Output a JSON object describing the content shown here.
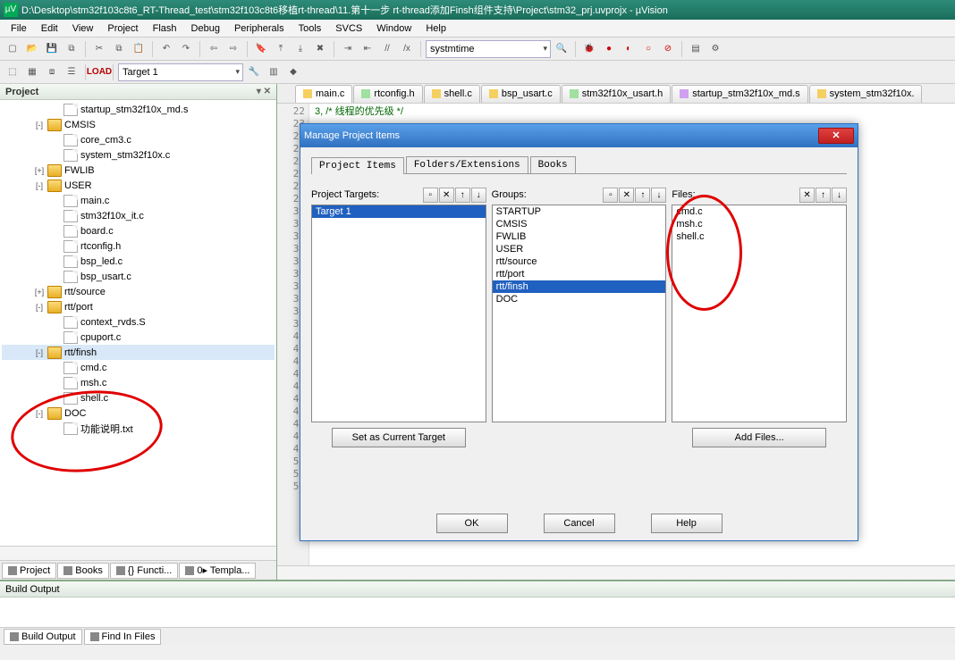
{
  "title": "D:\\Desktop\\stm32f103c8t6_RT-Thread_test\\stm32f103c8t6移植rt-thread\\11.第十一步 rt-thread添加Finsh组件支持\\Project\\stm32_prj.uvprojx - µVision",
  "menu": [
    "File",
    "Edit",
    "View",
    "Project",
    "Flash",
    "Debug",
    "Peripherals",
    "Tools",
    "SVCS",
    "Window",
    "Help"
  ],
  "toolbar2": {
    "target": "Target 1",
    "search": "systmtime"
  },
  "project_pane": {
    "title": "Project",
    "tabs": [
      "Project",
      "Books",
      "{} Functi...",
      "0▸ Templa..."
    ]
  },
  "tree": [
    {
      "d": 3,
      "t": "file",
      "l": "startup_stm32f10x_md.s"
    },
    {
      "d": 2,
      "t": "folder",
      "e": "-",
      "l": "CMSIS"
    },
    {
      "d": 3,
      "t": "file",
      "l": "core_cm3.c"
    },
    {
      "d": 3,
      "t": "file",
      "l": "system_stm32f10x.c"
    },
    {
      "d": 2,
      "t": "folder",
      "e": "+",
      "l": "FWLIB"
    },
    {
      "d": 2,
      "t": "folder",
      "e": "-",
      "l": "USER"
    },
    {
      "d": 3,
      "t": "file",
      "l": "main.c"
    },
    {
      "d": 3,
      "t": "file",
      "l": "stm32f10x_it.c"
    },
    {
      "d": 3,
      "t": "file",
      "l": "board.c"
    },
    {
      "d": 3,
      "t": "file",
      "l": "rtconfig.h"
    },
    {
      "d": 3,
      "t": "file",
      "l": "bsp_led.c"
    },
    {
      "d": 3,
      "t": "file",
      "l": "bsp_usart.c"
    },
    {
      "d": 2,
      "t": "folder",
      "e": "+",
      "l": "rtt/source"
    },
    {
      "d": 2,
      "t": "folder",
      "e": "-",
      "l": "rtt/port"
    },
    {
      "d": 3,
      "t": "file",
      "l": "context_rvds.S"
    },
    {
      "d": 3,
      "t": "file",
      "l": "cpuport.c"
    },
    {
      "d": 2,
      "t": "folder",
      "e": "-",
      "l": "rtt/finsh",
      "sel": true
    },
    {
      "d": 3,
      "t": "file",
      "l": "cmd.c"
    },
    {
      "d": 3,
      "t": "file",
      "l": "msh.c"
    },
    {
      "d": 3,
      "t": "file",
      "l": "shell.c"
    },
    {
      "d": 2,
      "t": "folder",
      "e": "-",
      "l": "DOC"
    },
    {
      "d": 3,
      "t": "file",
      "l": "功能说明.txt"
    }
  ],
  "editor_tabs": [
    {
      "l": "main.c",
      "k": "c",
      "a": true
    },
    {
      "l": "rtconfig.h",
      "k": "h"
    },
    {
      "l": "shell.c",
      "k": "c"
    },
    {
      "l": "bsp_usart.c",
      "k": "c"
    },
    {
      "l": "stm32f10x_usart.h",
      "k": "h"
    },
    {
      "l": "startup_stm32f10x_md.s",
      "k": "s"
    },
    {
      "l": "system_stm32f10x.",
      "k": "c"
    }
  ],
  "gutter_start": 22,
  "gutter_end": 52,
  "code_line": "3,                           /*  线程的优先级  */",
  "buildout": {
    "title": "Build Output",
    "tabs": [
      "Build Output",
      "Find In Files"
    ]
  },
  "dialog": {
    "title": "Manage Project Items",
    "tabs": [
      "Project Items",
      "Folders/Extensions",
      "Books"
    ],
    "col1": {
      "label": "Project Targets:",
      "items": [
        "Target 1"
      ],
      "sel": 0,
      "btn": "Set as Current Target"
    },
    "col2": {
      "label": "Groups:",
      "items": [
        "STARTUP",
        "CMSIS",
        "FWLIB",
        "USER",
        "rtt/source",
        "rtt/port",
        "rtt/finsh",
        "DOC"
      ],
      "sel": 6
    },
    "col3": {
      "label": "Files:",
      "items": [
        "cmd.c",
        "msh.c",
        "shell.c"
      ],
      "btn": "Add Files..."
    },
    "footer": [
      "OK",
      "Cancel",
      "Help"
    ]
  }
}
